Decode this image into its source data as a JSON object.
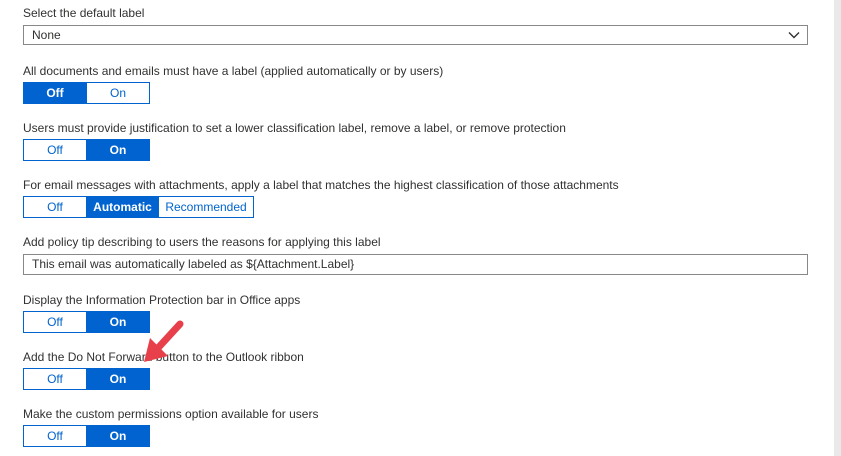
{
  "default_label": {
    "label": "Select the default label",
    "value": "None"
  },
  "mandatory_label": {
    "label": "All documents and emails must have a label (applied automatically or by users)",
    "options": [
      "Off",
      "On"
    ],
    "selected": "Off"
  },
  "justification": {
    "label": "Users must provide justification to set a lower classification label, remove a label, or remove protection",
    "options": [
      "Off",
      "On"
    ],
    "selected": "On"
  },
  "attachments_label": {
    "label": "For email messages with attachments, apply a label that matches the highest classification of those attachments",
    "options": [
      "Off",
      "Automatic",
      "Recommended"
    ],
    "selected": "Automatic"
  },
  "policy_tip": {
    "label": "Add policy tip describing to users the reasons for applying this label",
    "value": "This email was automatically labeled as ${Attachment.Label}"
  },
  "info_protection_bar": {
    "label": "Display the Information Protection bar in Office apps",
    "options": [
      "Off",
      "On"
    ],
    "selected": "On"
  },
  "do_not_forward": {
    "label": "Add the Do Not Forward button to the Outlook ribbon",
    "options": [
      "Off",
      "On"
    ],
    "selected": "On"
  },
  "custom_permissions": {
    "label": "Make the custom permissions option available for users",
    "options": [
      "Off",
      "On"
    ],
    "selected": "On"
  },
  "colors": {
    "accent": "#0063cf",
    "arrow": "#e8404a"
  },
  "icons": {
    "dropdown": "chevron-down-icon",
    "annotation": "red-arrow-icon"
  }
}
